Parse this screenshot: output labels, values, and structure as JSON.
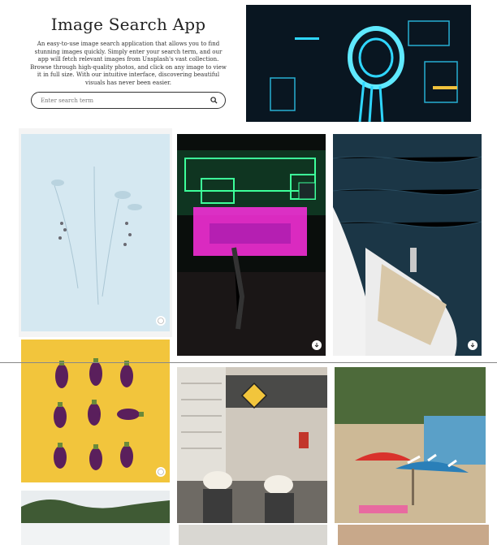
{
  "app": {
    "title": "Image Search App",
    "description": "An easy-to-use image search application that allows you to find stunning images quickly. Simply enter your search term, and our app will fetch relevant images from Unsplash's vast collection. Browse through high-quality photos, and click on any image to view it in full size. With our intuitive interface, discovering beautiful visuals has never been easier."
  },
  "search": {
    "placeholder": "Enter search term",
    "value": ""
  },
  "gallery": {
    "tiles": [
      {
        "subject": "pale dried flowers on light blue background",
        "icon": "download-icon"
      },
      {
        "subject": "neon-lit street at night",
        "icon": "download-icon"
      },
      {
        "subject": "white boat on dark blue sea",
        "icon": "download-icon"
      },
      {
        "subject": "eggplants on yellow background",
        "icon": "download-icon"
      },
      {
        "subject": "train station platform with children",
        "icon": "download-icon"
      },
      {
        "subject": "beach with striped umbrellas",
        "icon": "download-icon"
      }
    ]
  },
  "colors": {
    "text": "#222222",
    "neon_blue": "#2fd6ff",
    "neon_pink": "#ff2fe0",
    "sea": "#1d3a4c",
    "yellow": "#f0c23c",
    "eggplant": "#5a1f5c"
  }
}
